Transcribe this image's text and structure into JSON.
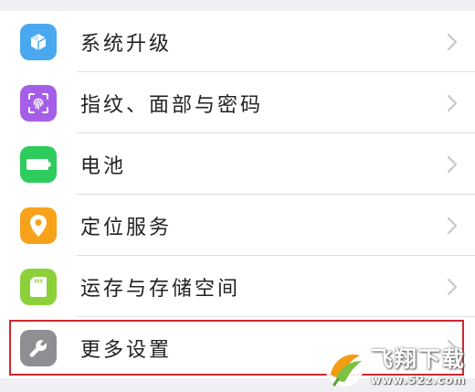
{
  "settings": {
    "items": [
      {
        "label": "系统升级",
        "icon": "system-update-icon",
        "color": "#4aa8f0"
      },
      {
        "label": "指纹、面部与密码",
        "icon": "fingerprint-icon",
        "color": "#a55ee8"
      },
      {
        "label": "电池",
        "icon": "battery-icon",
        "color": "#2ecc5c"
      },
      {
        "label": "定位服务",
        "icon": "location-icon",
        "color": "#f7a21b"
      },
      {
        "label": "运存与存储空间",
        "icon": "storage-icon",
        "color": "#8dd13a"
      },
      {
        "label": "更多设置",
        "icon": "wrench-icon",
        "color": "#8e8e93"
      }
    ]
  },
  "highlight": {
    "color": "#d2262f"
  },
  "watermark": {
    "title": "飞翔下载",
    "url": "www.52z.com"
  }
}
